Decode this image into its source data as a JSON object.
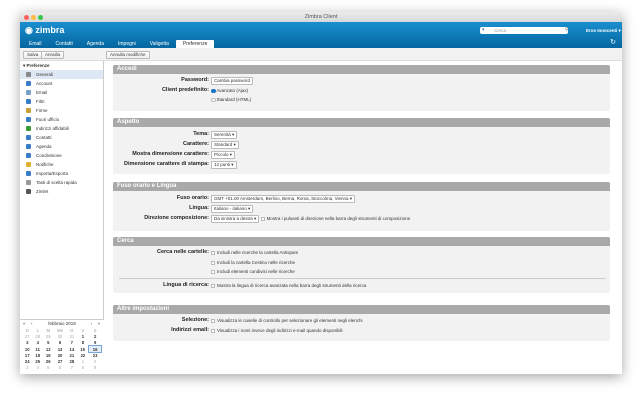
{
  "window": {
    "title": "Zimbra Client"
  },
  "header": {
    "logo": "zimbra",
    "search_placeholder": "Cerca",
    "user": "Eros Innocenti"
  },
  "tabs": [
    "Email",
    "Contatti",
    "Agenda",
    "Impegni",
    "Valigetta",
    "Preferenze"
  ],
  "toolbar": {
    "save": "Salva",
    "cancel": "Annulla",
    "undo": "Annulla modifiche"
  },
  "sidebar": {
    "title": "Preferenze",
    "items": [
      {
        "label": "Generali",
        "color": "#888"
      },
      {
        "label": "Account",
        "color": "#3b7dc4"
      },
      {
        "label": "Email",
        "color": "#7aa0c8"
      },
      {
        "label": "Filtri",
        "color": "#3b7dc4"
      },
      {
        "label": "Firme",
        "color": "#c8a03b"
      },
      {
        "label": "Fuori ufficio",
        "color": "#3b7dc4"
      },
      {
        "label": "Indirizzi affidabili",
        "color": "#3a9a3a"
      },
      {
        "label": "Contatti",
        "color": "#3b7dc4"
      },
      {
        "label": "Agenda",
        "color": "#3b7dc4"
      },
      {
        "label": "Condivisione",
        "color": "#3b7dc4"
      },
      {
        "label": "Notifiche",
        "color": "#e0b030"
      },
      {
        "label": "Importa/Esporta",
        "color": "#3b7dc4"
      },
      {
        "label": "Tasti di scelta rapida",
        "color": "#999"
      },
      {
        "label": "Zimlet",
        "color": "#555"
      }
    ]
  },
  "calendar": {
    "month": "febbraio 2019",
    "days": [
      "D",
      "L",
      "M",
      "Me",
      "G",
      "V",
      "S"
    ],
    "weeks": [
      [
        "27",
        "28",
        "29",
        "30",
        "31",
        "1",
        "2"
      ],
      [
        "3",
        "4",
        "5",
        "6",
        "7",
        "8",
        "9"
      ],
      [
        "10",
        "11",
        "12",
        "13",
        "14",
        "15",
        "16"
      ],
      [
        "17",
        "18",
        "19",
        "20",
        "21",
        "22",
        "23"
      ],
      [
        "24",
        "25",
        "26",
        "27",
        "28",
        "1",
        "2"
      ],
      [
        "3",
        "4",
        "5",
        "6",
        "7",
        "8",
        "9"
      ]
    ],
    "today": "16"
  },
  "sections": {
    "accedi": {
      "title": "Accedi",
      "password_label": "Password:",
      "password_btn": "Cambia password",
      "client_label": "Client predefinito:",
      "client_opt1": "Avanzato (Ajax)",
      "client_opt2": "Standard (HTML)"
    },
    "aspetto": {
      "title": "Aspetto",
      "tema_label": "Tema:",
      "tema": "Serenità",
      "carattere_label": "Carattere:",
      "carattere": "Standard",
      "dim_label": "Mostra dimensione carattere:",
      "dim": "Piccolo",
      "stampa_label": "Dimensione carattere di stampa:",
      "stampa": "12 punti"
    },
    "fuso": {
      "title": "Fuso orario e Lingua",
      "fuso_label": "Fuso orario:",
      "fuso": "GMT +01.00 Amsterdam, Berlino, Berna, Roma, Stoccolma, Vienna",
      "lingua_label": "Lingua:",
      "lingua": "Italiano - italiano",
      "dir_label": "Direzione composizione:",
      "dir": "Da sinistra a destra",
      "dir_cb": "Mostra i pulsanti di direzione nella barra degli strumenti di composizione"
    },
    "cerca": {
      "title": "Cerca",
      "cartelle_label": "Cerca nelle cartelle:",
      "opt1": "Includi nelle ricerche la cartella Antispam",
      "opt2": "Includi la cartella Cestino nelle ricerche",
      "opt3": "Includi elementi condivisi nelle ricerche",
      "lingua_label": "Lingua di ricerca:",
      "lingua_opt": "Mostra la lingua di ricerca avanzata nella barra degli strumenti della ricerca"
    },
    "altre": {
      "title": "Altre impostazioni",
      "sel_label": "Selezione:",
      "sel_opt": "Visualizza le caselle di controllo per selezionare gli elementi negli elenchi",
      "ind_label": "Indirizzi email:",
      "ind_opt": "Visualizza i nomi invece degli indirizzi e-mail quando disponibili"
    }
  }
}
